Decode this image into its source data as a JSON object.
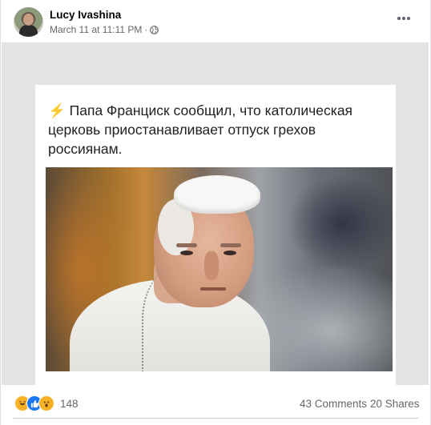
{
  "post": {
    "author": "Lucy Ivashina",
    "timestamp": "March 11 at 11:11 PM",
    "separator": "·",
    "audience_icon": "globe-icon",
    "more_icon": "more-options-icon"
  },
  "meme": {
    "icon": "⚡",
    "text": "Папа Франциск сообщил, что католическая церковь приостанавливает отпуск грехов россиянам."
  },
  "stats": {
    "reactions": [
      "haha",
      "like",
      "wow"
    ],
    "reaction_count": "148",
    "comments": "43 Comments",
    "shares": "20 Shares"
  },
  "colors": {
    "like_blue": "#1877f2",
    "reaction_yellow": "#f7b125",
    "secondary_text": "#65676b"
  }
}
